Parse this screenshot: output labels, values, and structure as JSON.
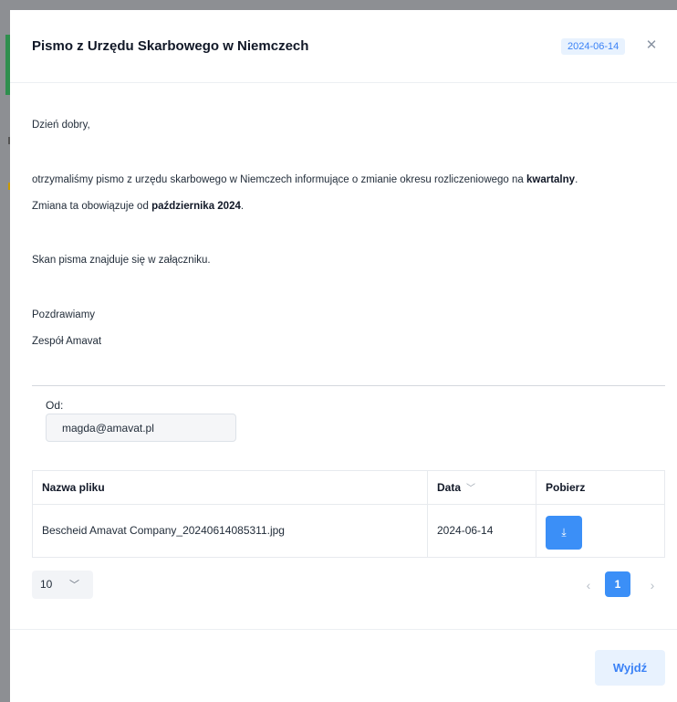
{
  "modal": {
    "title": "Pismo z Urzędu Skarbowego w Niemczech",
    "date_badge": "2024-06-14",
    "close_icon": "close-icon"
  },
  "message": {
    "greeting": "Dzień dobry,",
    "line1_text": "otrzymaliśmy pismo z urzędu skarbowego w Niemczech informujące o zmianie okresu rozliczeniowego na ",
    "line1_bold": "kwartalny",
    "line1_end": ".",
    "line2_text": "Zmiana ta obowiązuje od ",
    "line2_bold": "października 2024",
    "line2_end": ".",
    "attachment_note": "Skan pisma znajduje się w załączniku.",
    "closing": "Pozdrawiamy",
    "signature": "Zespół Amavat"
  },
  "from": {
    "label": "Od:",
    "value": "magda@amavat.pl"
  },
  "table": {
    "headers": [
      "Nazwa pliku",
      "Data",
      "Pobierz"
    ],
    "sort_icon": "chevron-down-icon",
    "rows": [
      {
        "filename": "Bescheid Amavat Company_20240614085311.jpg",
        "date": "2024-06-14",
        "download_icon": "download-icon"
      }
    ]
  },
  "pagination": {
    "page_size": "10",
    "current_page": "1"
  },
  "footer": {
    "exit_label": "Wyjdź"
  },
  "colors": {
    "accent": "#3b8ff7",
    "badge_bg": "#e8f2fe"
  }
}
